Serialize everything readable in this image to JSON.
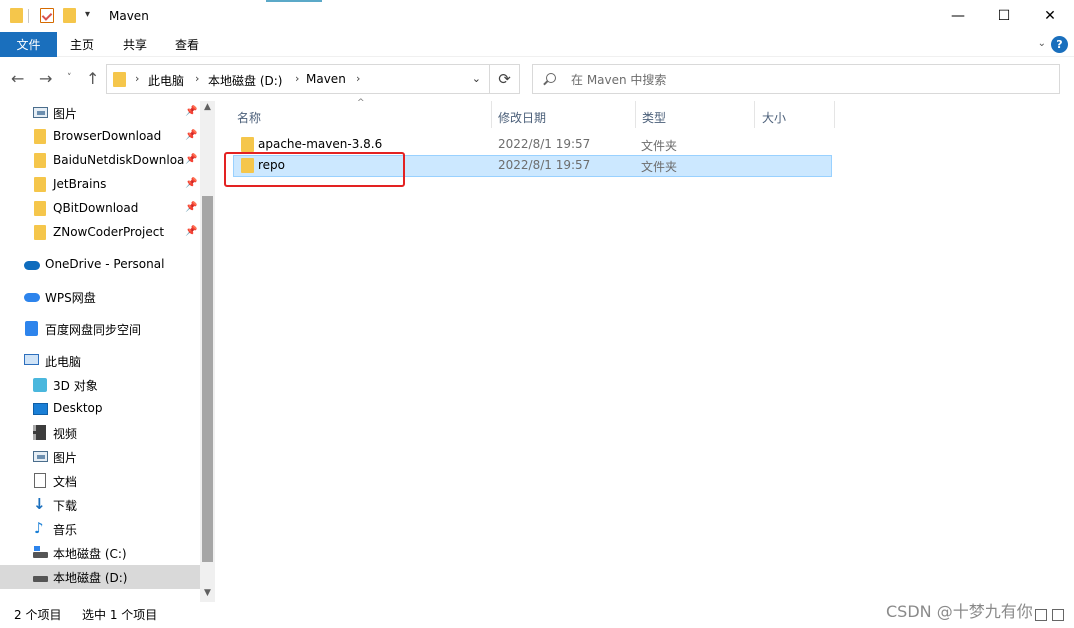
{
  "title_bar": {
    "window_title": "Maven",
    "minimize": "—",
    "maximize": "☐",
    "close": "✕"
  },
  "ribbon": {
    "tabs": [
      "文件",
      "主页",
      "共享",
      "查看"
    ],
    "help": "?"
  },
  "nav": {
    "back": "←",
    "forward": "→",
    "recent": "˅",
    "up": "↑",
    "breadcrumb": [
      "此电脑",
      "本地磁盘 (D:)",
      "Maven"
    ],
    "search_placeholder": "在 Maven 中搜索",
    "refresh": "⟳"
  },
  "sidebar": {
    "items": [
      {
        "label": "图片",
        "icon": "pictures-icon",
        "pinned": true
      },
      {
        "label": "BrowserDownload",
        "icon": "folder-icon",
        "pinned": true
      },
      {
        "label": "BaiduNetdiskDownloa",
        "icon": "folder-icon",
        "pinned": true
      },
      {
        "label": "JetBrains",
        "icon": "folder-icon",
        "pinned": true
      },
      {
        "label": "QBitDownload",
        "icon": "folder-icon",
        "pinned": true
      },
      {
        "label": "ZNowCoderProject",
        "icon": "folder-icon",
        "pinned": true
      },
      {
        "label": "OneDrive - Personal",
        "icon": "onedrive-icon"
      },
      {
        "label": "WPS网盘",
        "icon": "wps-cloud-icon"
      },
      {
        "label": "百度网盘同步空间",
        "icon": "baidu-netdisk-icon"
      },
      {
        "label": "此电脑",
        "icon": "this-pc-icon"
      },
      {
        "label": "3D 对象",
        "icon": "3d-objects-icon"
      },
      {
        "label": "Desktop",
        "icon": "desktop-icon"
      },
      {
        "label": "视频",
        "icon": "videos-icon"
      },
      {
        "label": "图片",
        "icon": "pictures-icon"
      },
      {
        "label": "文档",
        "icon": "documents-icon"
      },
      {
        "label": "下载",
        "icon": "downloads-icon"
      },
      {
        "label": "音乐",
        "icon": "music-icon"
      },
      {
        "label": "本地磁盘 (C:)",
        "icon": "drive-c-icon"
      },
      {
        "label": "本地磁盘 (D:)",
        "icon": "drive-d-icon",
        "selected": true
      }
    ]
  },
  "columns": [
    "名称",
    "修改日期",
    "类型",
    "大小"
  ],
  "files": [
    {
      "name": "apache-maven-3.8.6",
      "date": "2022/8/1 19:57",
      "type": "文件夹",
      "selected": false
    },
    {
      "name": "repo",
      "date": "2022/8/1 19:57",
      "type": "文件夹",
      "selected": true
    }
  ],
  "status": {
    "item_count": "2 个项目",
    "selected_count": "选中 1 个项目"
  },
  "watermark": "CSDN @十梦九有你",
  "colors": {
    "accent": "#1a6fbd",
    "selection": "#cce8ff",
    "folder": "#f5c64b",
    "highlight_box": "#e32222"
  }
}
